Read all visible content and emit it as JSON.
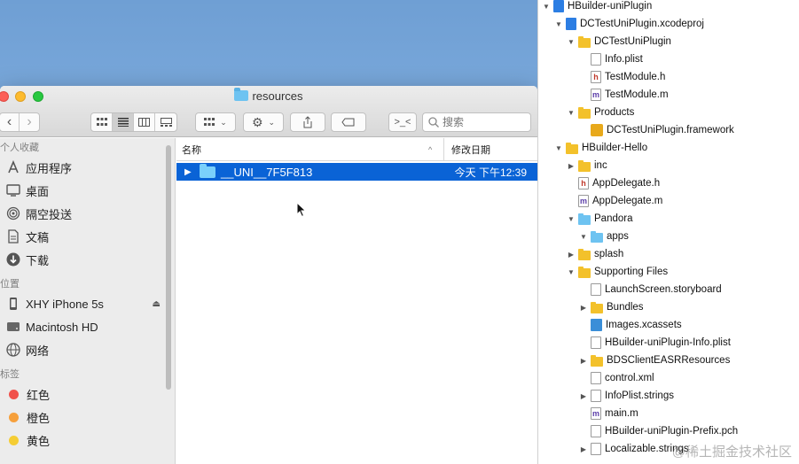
{
  "finder": {
    "title": "resources",
    "search_placeholder": "搜索",
    "toolbar": {
      "back": "‹",
      "forward": "›",
      "tag_btn": "⌐",
      "terminal_btn": ">_<"
    },
    "sidebar": {
      "sections": [
        {
          "header": "个人收藏",
          "items": [
            {
              "label": "应用程序",
              "icon": "applications-icon"
            },
            {
              "label": "桌面",
              "icon": "desktop-icon"
            },
            {
              "label": "隔空投送",
              "icon": "airdrop-icon"
            },
            {
              "label": "文稿",
              "icon": "documents-icon"
            },
            {
              "label": "下载",
              "icon": "downloads-icon"
            }
          ]
        },
        {
          "header": "位置",
          "items": [
            {
              "label": "XHY iPhone 5s",
              "icon": "iphone-icon"
            },
            {
              "label": "Macintosh HD",
              "icon": "harddisk-icon"
            },
            {
              "label": "网络",
              "icon": "network-icon"
            }
          ]
        },
        {
          "header": "标签",
          "items": [
            {
              "label": "红色",
              "color": "#f0514b"
            },
            {
              "label": "橙色",
              "color": "#f6a03c"
            },
            {
              "label": "黄色",
              "color": "#f5cd34"
            }
          ]
        }
      ]
    },
    "columns": {
      "name": "名称",
      "date": "修改日期"
    },
    "rows": [
      {
        "name": "__UNI__7F5F813",
        "date": "今天 下午12:39"
      }
    ]
  },
  "xcode": {
    "tree": [
      {
        "label": "HBuilder-uniPlugin",
        "icon": "project-icon",
        "depth": 0,
        "open": true
      },
      {
        "label": "DCTestUniPlugin.xcodeproj",
        "icon": "project-icon",
        "depth": 1,
        "open": true
      },
      {
        "label": "DCTestUniPlugin",
        "icon": "folder-icon",
        "depth": 2,
        "open": true
      },
      {
        "label": "Info.plist",
        "icon": "file-icon",
        "depth": 3
      },
      {
        "label": "TestModule.h",
        "icon": "header-file-icon",
        "depth": 3
      },
      {
        "label": "TestModule.m",
        "icon": "source-file-icon",
        "depth": 3
      },
      {
        "label": "Products",
        "icon": "folder-icon",
        "depth": 2,
        "open": true
      },
      {
        "label": "DCTestUniPlugin.framework",
        "icon": "framework-icon",
        "depth": 3
      },
      {
        "label": "HBuilder-Hello",
        "icon": "folder-icon",
        "depth": 1,
        "open": true
      },
      {
        "label": "inc",
        "icon": "folder-icon",
        "depth": 2,
        "open": false
      },
      {
        "label": "AppDelegate.h",
        "icon": "header-file-icon",
        "depth": 2
      },
      {
        "label": "AppDelegate.m",
        "icon": "source-file-icon",
        "depth": 2
      },
      {
        "label": "Pandora",
        "icon": "blue-folder-icon",
        "depth": 2,
        "open": true
      },
      {
        "label": "apps",
        "icon": "blue-folder-icon",
        "depth": 3,
        "open": true
      },
      {
        "label": "splash",
        "icon": "folder-icon",
        "depth": 2,
        "open": false
      },
      {
        "label": "Supporting Files",
        "icon": "folder-icon",
        "depth": 2,
        "open": true
      },
      {
        "label": "LaunchScreen.storyboard",
        "icon": "file-icon",
        "depth": 3
      },
      {
        "label": "Bundles",
        "icon": "folder-icon",
        "depth": 3,
        "open": false
      },
      {
        "label": "Images.xcassets",
        "icon": "assets-icon",
        "depth": 3
      },
      {
        "label": "HBuilder-uniPlugin-Info.plist",
        "icon": "file-icon",
        "depth": 3
      },
      {
        "label": "BDSClientEASRResources",
        "icon": "folder-icon",
        "depth": 3,
        "open": false
      },
      {
        "label": "control.xml",
        "icon": "file-icon",
        "depth": 3
      },
      {
        "label": "InfoPlist.strings",
        "icon": "file-icon",
        "depth": 3,
        "open": false
      },
      {
        "label": "main.m",
        "icon": "source-file-icon",
        "depth": 3
      },
      {
        "label": "HBuilder-uniPlugin-Prefix.pch",
        "icon": "file-icon",
        "depth": 3
      },
      {
        "label": "Localizable.strings",
        "icon": "file-icon",
        "depth": 3,
        "open": false
      }
    ],
    "watermark": "@稀土掘金技术社区"
  }
}
